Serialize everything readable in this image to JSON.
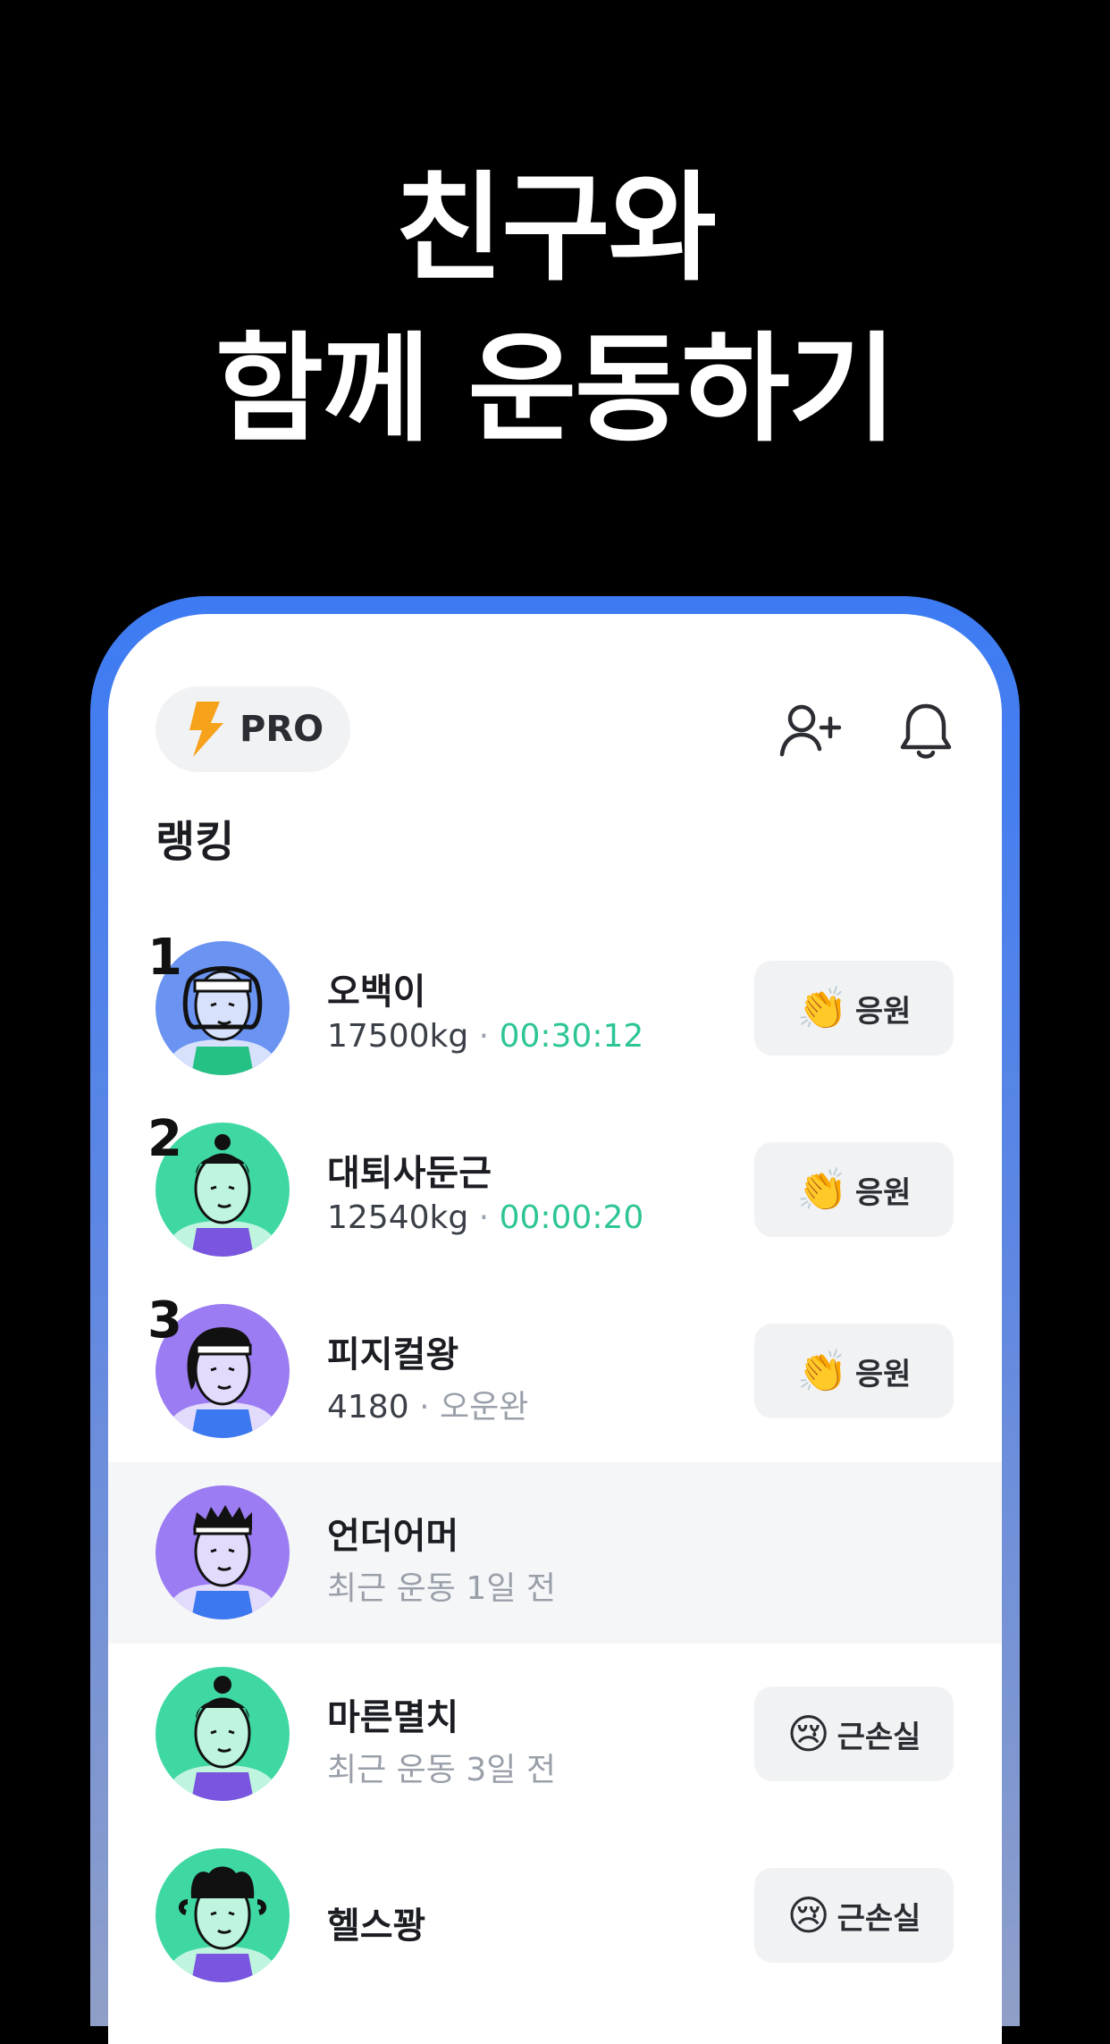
{
  "headline": {
    "line1": "친구와",
    "line2": "함께 운동하기"
  },
  "header": {
    "pro_label": "PRO"
  },
  "section_title": "랭킹",
  "colors": {
    "accent_green": "#2ec596",
    "phone_frame": "#3d7bf3"
  },
  "ranking": [
    {
      "rank": "1",
      "name": "오백이",
      "weight": "17500kg",
      "sep": " · ",
      "time": "00:30:12",
      "button": "응원",
      "button_icon": "clapping-hands-icon"
    },
    {
      "rank": "2",
      "name": "대퇴사둔근",
      "weight": "12540kg",
      "sep": " · ",
      "time": "00:00:20",
      "button": "응원",
      "button_icon": "clapping-hands-icon"
    },
    {
      "rank": "3",
      "name": "피지컬왕",
      "weight": "4180",
      "sep": " · ",
      "status": "오운완",
      "button": "응원",
      "button_icon": "clapping-hands-icon"
    },
    {
      "name": "언더어머",
      "recent": "최근 운동 1일 전"
    },
    {
      "name": "마른멸치",
      "recent": "최근 운동 3일 전",
      "button": "근손실",
      "button_icon": "crying-face-icon"
    },
    {
      "name": "헬스꽝",
      "button": "근손실",
      "button_icon": "crying-face-icon"
    }
  ]
}
